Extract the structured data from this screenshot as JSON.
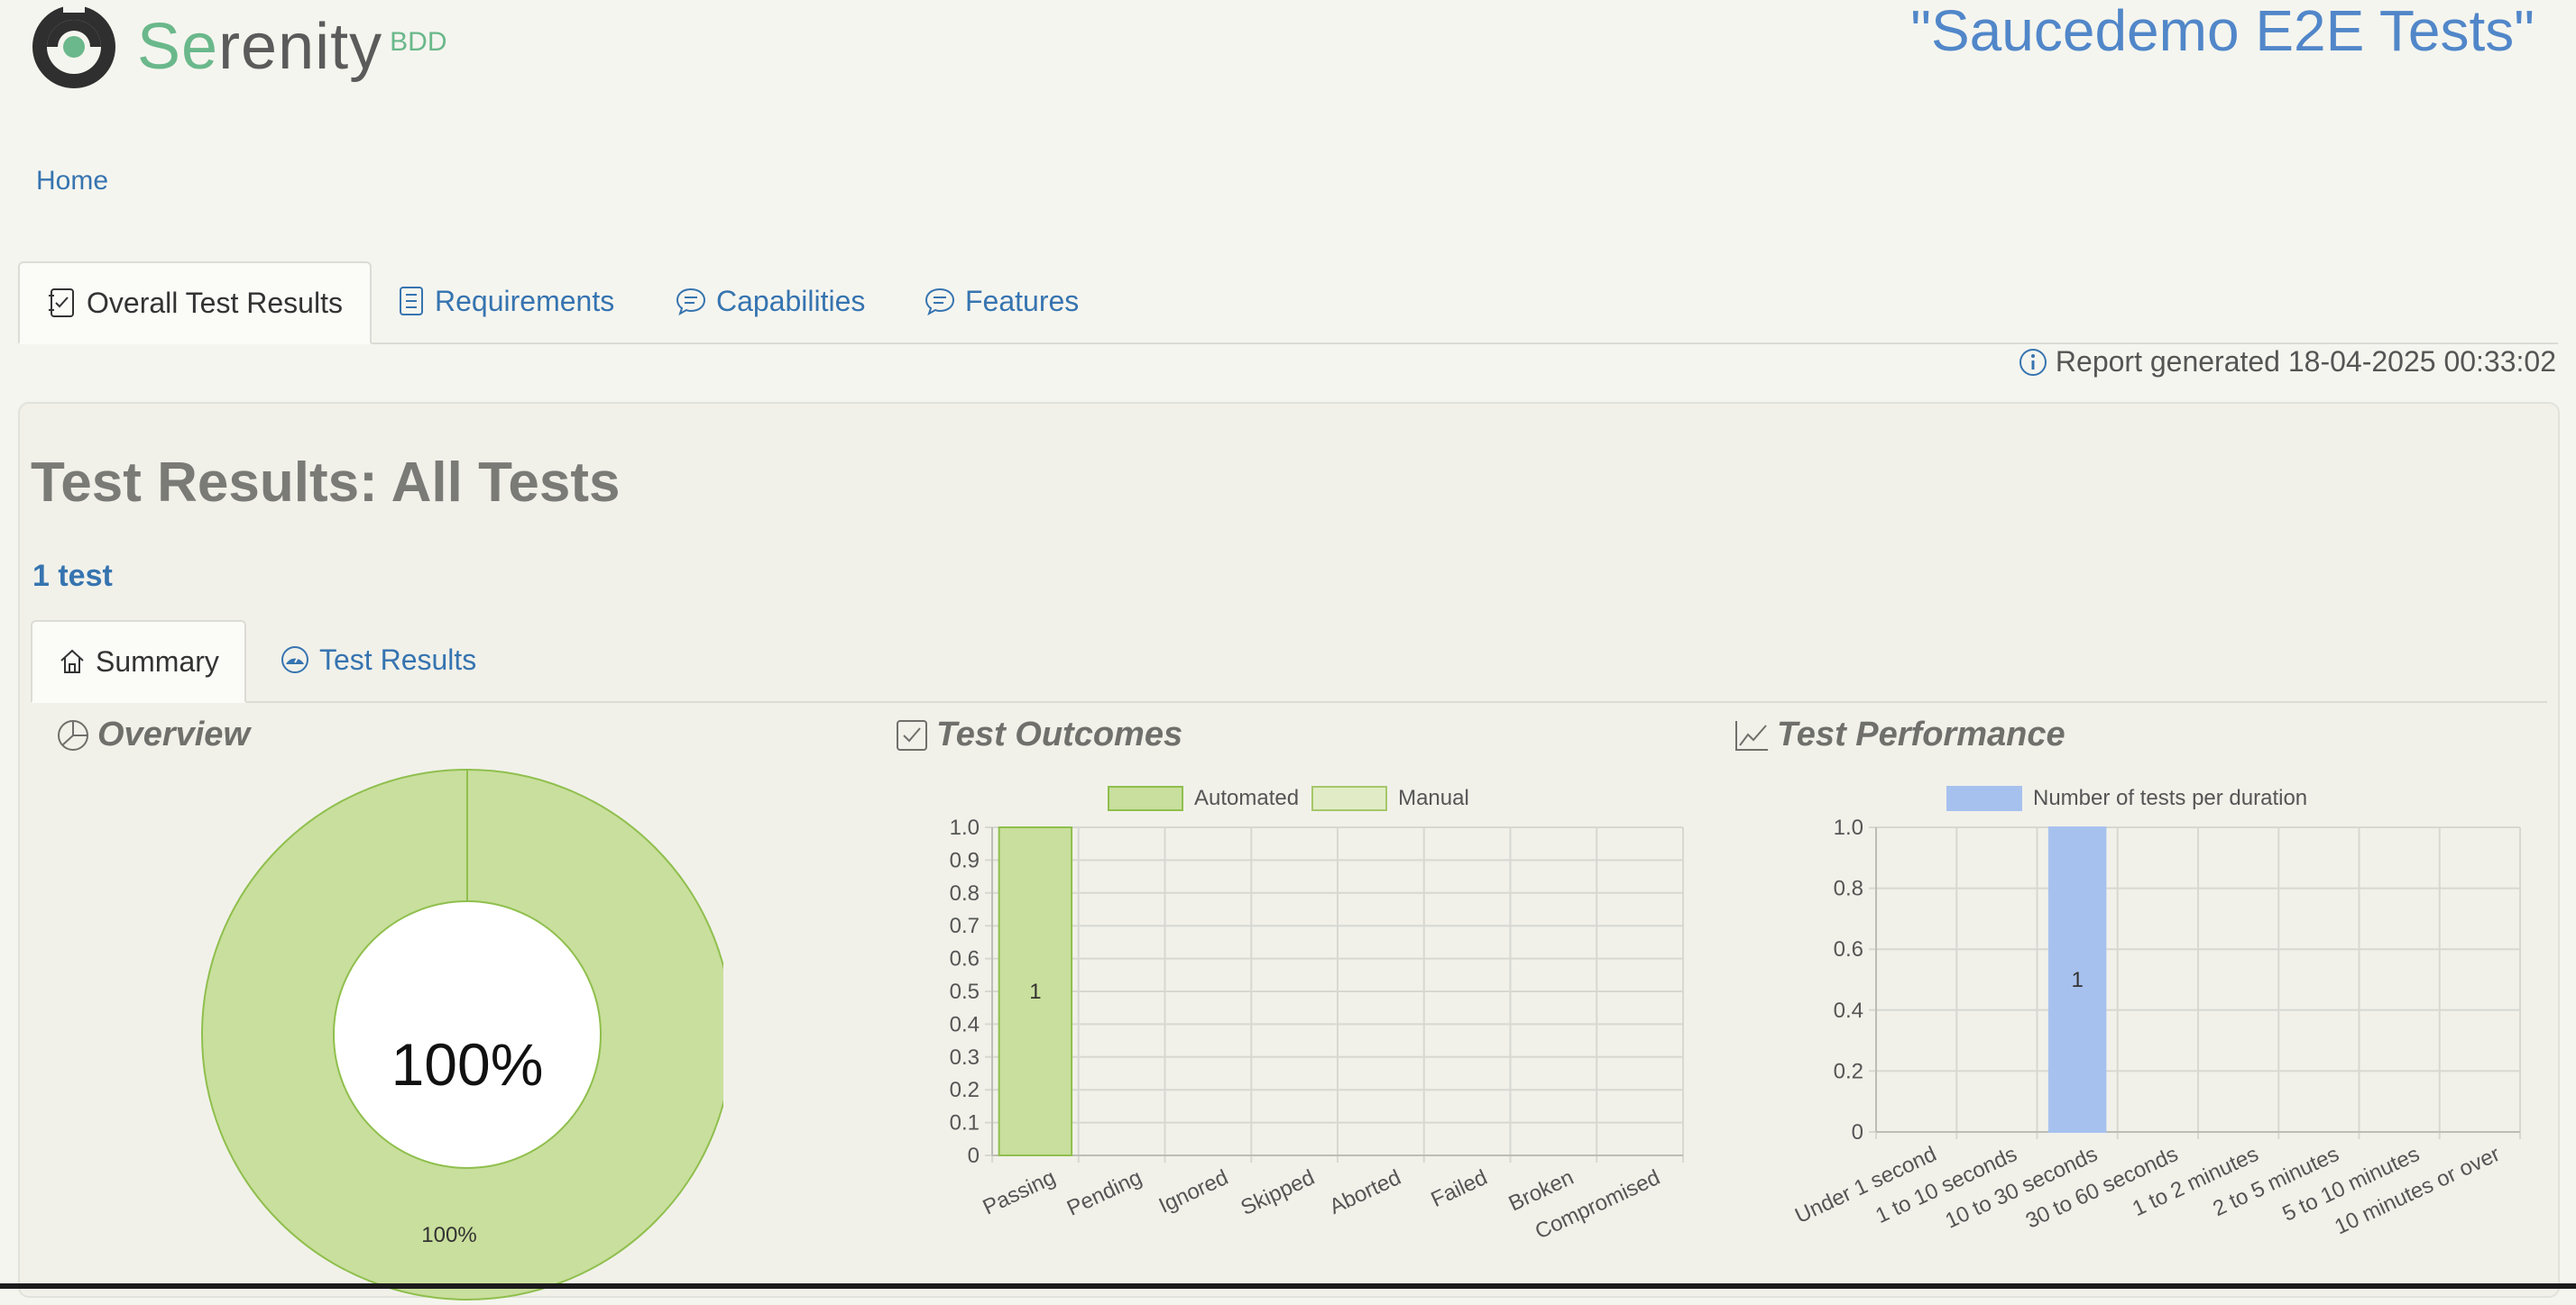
{
  "header": {
    "logo_word_prefix": "Se",
    "logo_word_rest": "renity",
    "logo_suffix": "BDD",
    "project_title": "\"Saucedemo E2E Tests\""
  },
  "breadcrumb": {
    "home": "Home"
  },
  "tabs": [
    {
      "label": "Overall Test Results",
      "icon": "checklist-icon"
    },
    {
      "label": "Requirements",
      "icon": "document-list-icon"
    },
    {
      "label": "Capabilities",
      "icon": "speech-bubble-icon"
    },
    {
      "label": "Features",
      "icon": "speech-bubble-icon"
    }
  ],
  "report_generated": "Report generated 18-04-2025 00:33:02",
  "main": {
    "heading": "Test Results: All Tests",
    "test_count": "1 test",
    "sub_tabs": [
      {
        "label": "Summary",
        "icon": "home-icon"
      },
      {
        "label": "Test Results",
        "icon": "gauge-icon"
      }
    ],
    "sections": {
      "overview": "Overview",
      "outcomes": "Test Outcomes",
      "performance": "Test Performance"
    }
  },
  "colors": {
    "passing": "#c9df9d",
    "passing_border": "#8fbf4d",
    "duration_bar": "#a7c1ef",
    "link": "#3674b0",
    "title_blue": "#5187c9"
  },
  "chart_data": [
    {
      "type": "pie",
      "name": "overview",
      "center_label": "100%",
      "slices": [
        {
          "label": "100%",
          "value": 100
        }
      ]
    },
    {
      "type": "bar",
      "name": "test-outcomes",
      "categories": [
        "Passing",
        "Pending",
        "Ignored",
        "Skipped",
        "Aborted",
        "Failed",
        "Broken",
        "Compromised"
      ],
      "series": [
        {
          "name": "Automated",
          "values": [
            1,
            0,
            0,
            0,
            0,
            0,
            0,
            0
          ]
        },
        {
          "name": "Manual",
          "values": [
            0,
            0,
            0,
            0,
            0,
            0,
            0,
            0
          ]
        }
      ],
      "ylim": [
        0,
        1
      ],
      "yticks": [
        "1.0",
        "0.9",
        "0.8",
        "0.7",
        "0.6",
        "0.5",
        "0.4",
        "0.3",
        "0.2",
        "0.1",
        "0"
      ],
      "data_labels": [
        "1"
      ],
      "legend": "top"
    },
    {
      "type": "bar",
      "name": "test-performance",
      "categories": [
        "Under 1 second",
        "1 to 10 seconds",
        "10 to 30 seconds",
        "30 to 60 seconds",
        "1 to 2 minutes",
        "2 to 5 minutes",
        "5 to 10 minutes",
        "10 minutes or over"
      ],
      "series": [
        {
          "name": "Number of tests per duration",
          "values": [
            0,
            0,
            1,
            0,
            0,
            0,
            0,
            0
          ]
        }
      ],
      "ylim": [
        0,
        1
      ],
      "yticks": [
        "1.0",
        "0.8",
        "0.6",
        "0.4",
        "0.2",
        "0"
      ],
      "data_labels": [
        "1"
      ],
      "legend": "top"
    }
  ]
}
